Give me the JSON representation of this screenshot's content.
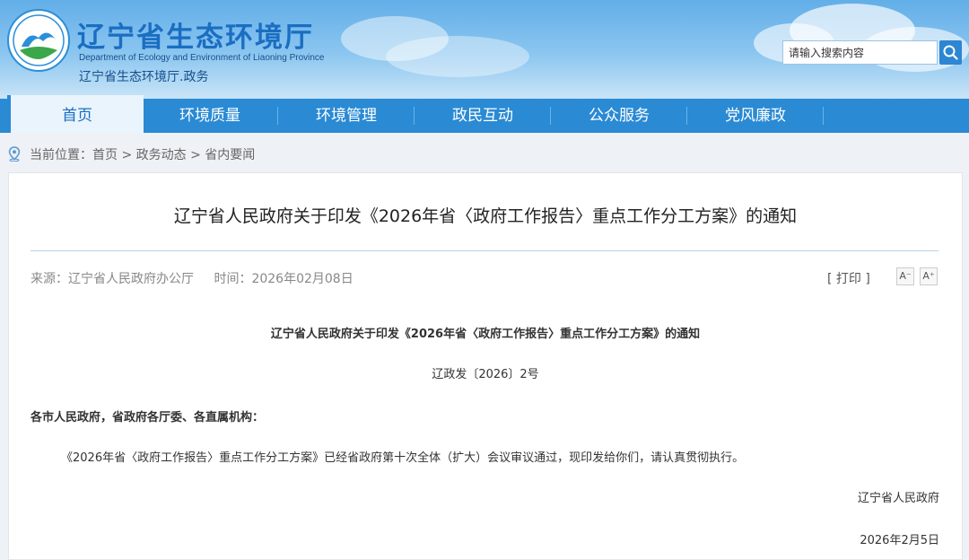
{
  "header": {
    "site_title": "辽宁省生态环境厅",
    "subtitle_en": "Department of Ecology and Environment of Liaoning Province",
    "subtitle_cn": "辽宁省生态环境厅.政务",
    "search_placeholder": "请输入搜索内容",
    "search_icon": "search-icon",
    "accent_color": "#2a8ad4"
  },
  "nav": {
    "items": [
      {
        "label": "首页",
        "active": true
      },
      {
        "label": "环境质量"
      },
      {
        "label": "环境管理"
      },
      {
        "label": "政民互动"
      },
      {
        "label": "公众服务"
      },
      {
        "label": "党风廉政"
      }
    ]
  },
  "breadcrumb": {
    "icon": "location-pin-icon",
    "prefix": "当前位置：",
    "items": [
      "首页",
      "政务动态",
      "省内要闻"
    ],
    "separator": " > "
  },
  "article": {
    "title": "辽宁省人民政府关于印发《2026年省〈政府工作报告〉重点工作分工方案》的通知",
    "source": "来源：辽宁省人民政府办公厅",
    "time": "时间：2026年02月08日",
    "print_label": "[ 打印 ]",
    "font_smaller": "A⁻",
    "font_larger": "A⁺",
    "doc_heading": "辽宁省人民政府关于印发《2026年省〈政府工作报告〉重点工作分工方案》的通知",
    "doc_number": "辽政发〔2026〕2号",
    "recipients": "各市人民政府，省政府各厅委、各直属机构：",
    "body": "《2026年省〈政府工作报告〉重点工作分工方案》已经省政府第十次全体（扩大）会议审议通过，现印发给你们，请认真贯彻执行。",
    "signature": "辽宁省人民政府",
    "date": "2026年2月5日"
  }
}
